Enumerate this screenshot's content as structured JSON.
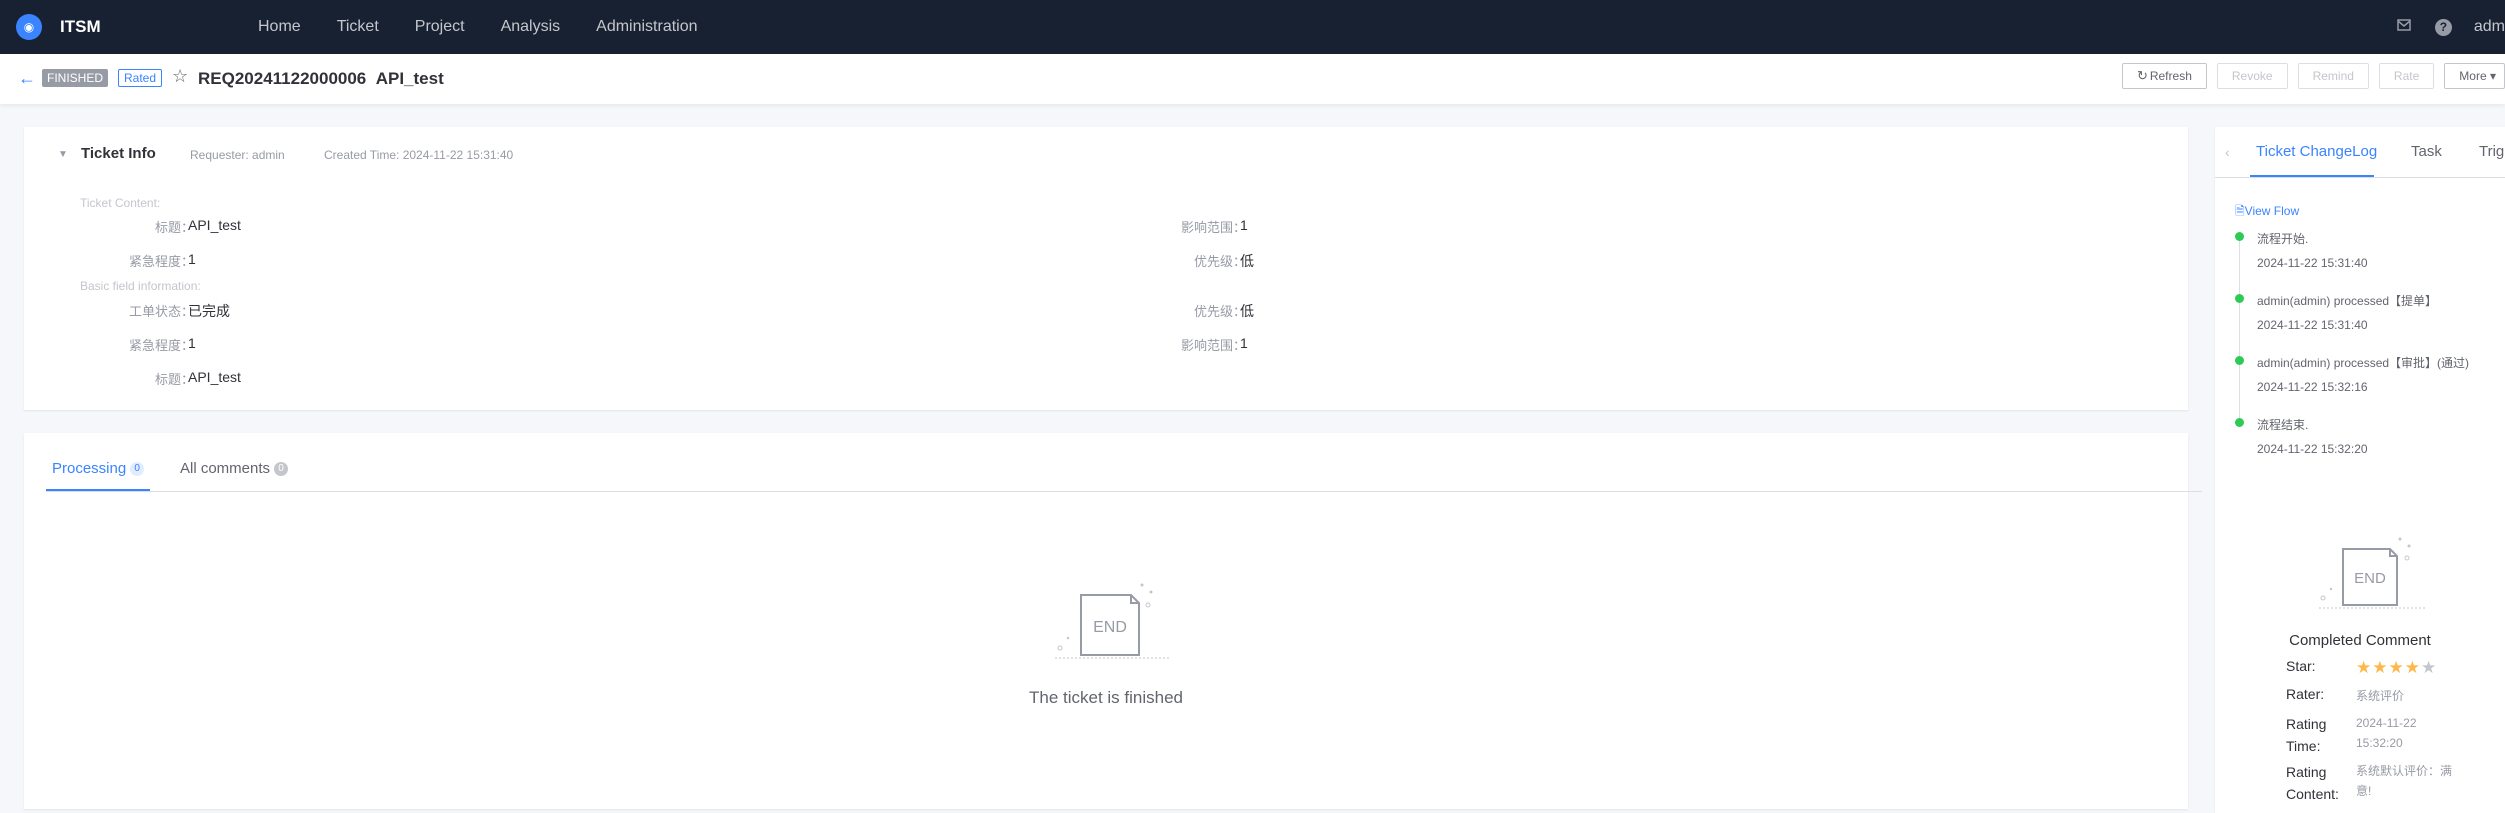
{
  "app": {
    "brand": "ITSM",
    "nav": [
      "Home",
      "Ticket",
      "Project",
      "Analysis",
      "Administration"
    ],
    "user": "adm"
  },
  "header": {
    "status_tag": "FINISHED",
    "rated_tag": "Rated",
    "ticket_id": "REQ20241122000006",
    "ticket_name": "API_test",
    "buttons": {
      "refresh": "Refresh",
      "revoke": "Revoke",
      "remind": "Remind",
      "rate": "Rate",
      "more": "More"
    }
  },
  "ticket_info": {
    "title": "Ticket Info",
    "requester": "Requester: admin",
    "created_time": "Created Time: 2024-11-22 15:31:40",
    "section_content": "Ticket Content:",
    "section_basic": "Basic field information:",
    "content_fields": [
      {
        "label": "标题：",
        "value": "API_test"
      },
      {
        "label": "影响范围：",
        "value": "1"
      },
      {
        "label": "紧急程度：",
        "value": "1"
      },
      {
        "label": "优先级：",
        "value": "低"
      }
    ],
    "basic_fields": [
      {
        "label": "工单状态：",
        "value": "已完成"
      },
      {
        "label": "优先级：",
        "value": "低"
      },
      {
        "label": "紧急程度：",
        "value": "1"
      },
      {
        "label": "影响范围：",
        "value": "1"
      },
      {
        "label": "标题：",
        "value": "API_test"
      }
    ]
  },
  "processing": {
    "tab_processing": "Processing",
    "tab_processing_count": "0",
    "tab_comments": "All comments",
    "tab_comments_count": "0",
    "empty_text": "The ticket is finished",
    "end_label": "END"
  },
  "right_panel": {
    "tabs": [
      "Ticket ChangeLog",
      "Task",
      "Trig"
    ],
    "view_flow": "View Flow",
    "timeline": [
      {
        "title": "流程开始.",
        "time": "2024-11-22 15:31:40"
      },
      {
        "title": "admin(admin) processed【提单】",
        "time": "2024-11-22 15:31:40"
      },
      {
        "title": "admin(admin) processed【审批】(通过)",
        "time": "2024-11-22 15:32:16"
      },
      {
        "title": "流程结束.",
        "time": "2024-11-22 15:32:20"
      }
    ],
    "end_label": "END",
    "completed_comment": {
      "title": "Completed Comment",
      "star_label": "Star:",
      "stars": 4,
      "stars_max": 5,
      "rater_label": "Rater:",
      "rater": "系统评价",
      "time_label": "Rating Time:",
      "time": "2024-11-22 15:32:20",
      "content_label": "Rating Content:",
      "content": "系统默认评价：满意!"
    }
  },
  "colors": {
    "topbar": "#182132",
    "primary": "#3a84ff",
    "success": "#2dcb56",
    "star": "#ffb848"
  }
}
